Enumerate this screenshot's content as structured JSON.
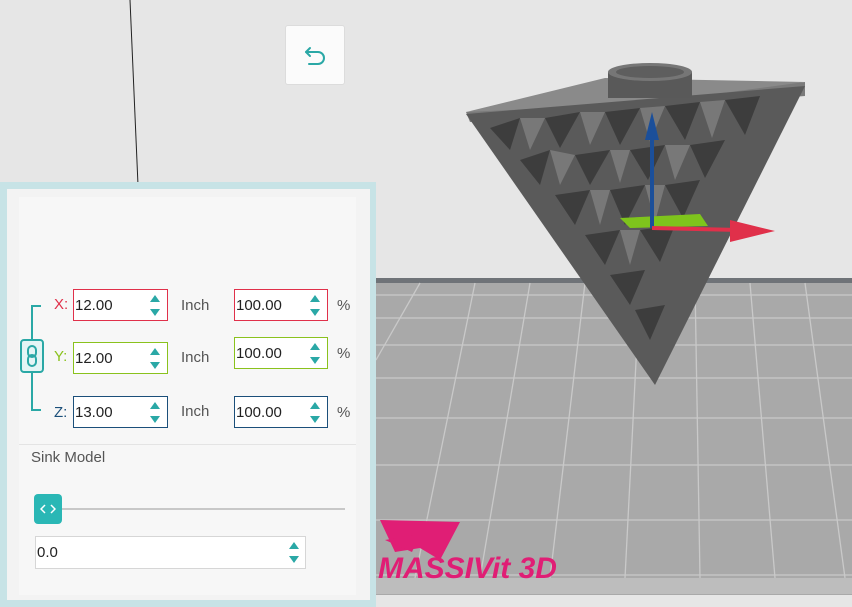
{
  "viewport": {
    "watermark": "MASSIVit 3D",
    "colors": {
      "background": "#e6e6e6",
      "floor": "#a9a9a9",
      "model": "#5c5c5c",
      "x_axis": "#e0304a",
      "y_axis": "#7ec41c",
      "z_axis": "#1b4f9a",
      "logo": "#e01e75"
    }
  },
  "scale_panel": {
    "reset_icon": "undo-icon",
    "rows": [
      {
        "axis": "X:",
        "value": "12.00",
        "unit": "Inch",
        "percent": "100.00",
        "percent_unit": "%",
        "color": "#e0304a"
      },
      {
        "axis": "Y:",
        "value": "12.00",
        "unit": "Inch",
        "percent": "100.00",
        "percent_unit": "%",
        "color": "#8ac21d"
      },
      {
        "axis": "Z:",
        "value": "13.00",
        "unit": "Inch",
        "percent": "100.00",
        "percent_unit": "%",
        "color": "#1b4f7a"
      }
    ],
    "link_icon": "chain-link-icon",
    "sink": {
      "label": "Sink Model",
      "value": "0.0",
      "slider_level": 0,
      "thumb_icon": "left-right-arrows-icon"
    },
    "accent_color": "#2aa8a6"
  }
}
